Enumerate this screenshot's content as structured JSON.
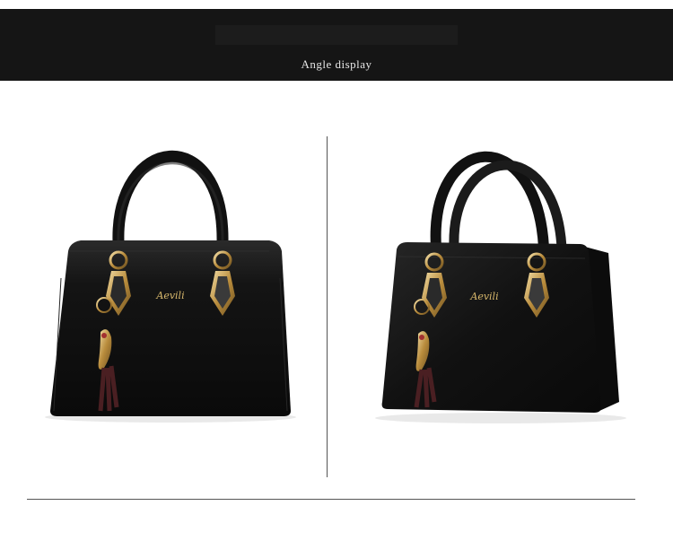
{
  "header": {
    "title": "Angle display"
  },
  "photos": [
    {
      "label": "handbag-front-view",
      "brand_text": "Aevili"
    },
    {
      "label": "handbag-angle-view",
      "brand_text": "Aevili"
    }
  ],
  "colors": {
    "banner": "#151515",
    "bag": "#121212",
    "hardware": "#c9a45a",
    "tassel": "#4a1f22",
    "divider": "#555555"
  }
}
